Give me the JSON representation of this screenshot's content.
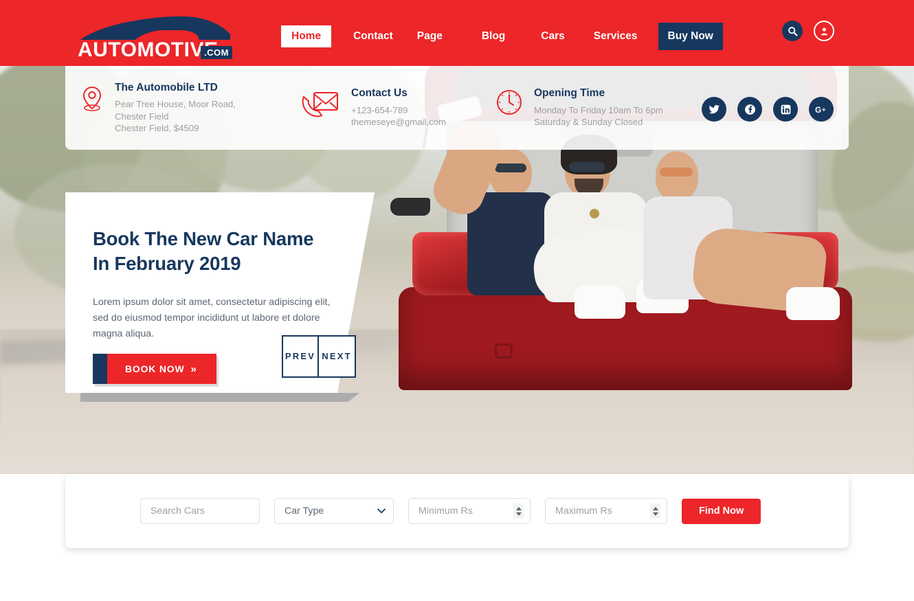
{
  "colors": {
    "brand_red": "#EC2629",
    "navy": "#17375E",
    "muted_text": "#9AA0A6",
    "body_text": "#5C6672"
  },
  "header": {
    "logo": {
      "word": "AUTOMOTIVE",
      "suffix": ".COM"
    },
    "nav": [
      {
        "label": "Home",
        "state": "active"
      },
      {
        "label": "Contact",
        "state": "normal"
      },
      {
        "label": "Page",
        "state": "normal"
      },
      {
        "label": "Blog",
        "state": "normal"
      },
      {
        "label": "Cars",
        "state": "normal"
      },
      {
        "label": "Services",
        "state": "normal"
      },
      {
        "label": "Buy Now",
        "state": "cta"
      }
    ],
    "icons": [
      {
        "name": "search-icon"
      },
      {
        "name": "user-account-icon"
      }
    ]
  },
  "contact_bar": {
    "blocks": [
      {
        "icon": "map-pin-icon",
        "title": "The Automobile LTD",
        "lines": [
          "Pear Tree House, Moor Road,",
          "Chester Field",
          "Chester Field, $4509"
        ]
      },
      {
        "icon": "envelope-phone-icon",
        "title": "Contact Us",
        "lines": [
          "+123-654-789",
          "themeseye@gmail.com"
        ]
      },
      {
        "icon": "clock-icon",
        "title": "Opening Time",
        "lines": [
          "Monday To Friday 10am To 6pm",
          "Saturday & Sunday Closed"
        ]
      }
    ],
    "socials": [
      {
        "name": "twitter-icon",
        "label": "Twitter"
      },
      {
        "name": "facebook-icon",
        "label": "Facebook"
      },
      {
        "name": "linkedin-icon",
        "label": "LinkedIn"
      },
      {
        "name": "google-plus-icon",
        "label": "Google Plus"
      }
    ]
  },
  "hero": {
    "title": "Book The New Car Name\nIn February 2019",
    "description": "Lorem ipsum dolor sit amet, consectetur adipiscing elit, sed do eiusmod tempor incididunt ut labore et dolore magna aliqua.",
    "book_button": "BOOK NOW",
    "book_button_chevron": "»",
    "slider_prev": "PREV",
    "slider_next": "NEXT"
  },
  "search": {
    "car_name_placeholder": "Search Cars",
    "car_name_value": "",
    "car_type_selected": "Car Type",
    "car_type_options": [
      "Car Type"
    ],
    "min_price_placeholder": "Minimum Rs",
    "min_price_value": "",
    "max_price_placeholder": "Maximum Rs",
    "max_price_value": "",
    "find_button": "Find Now"
  }
}
